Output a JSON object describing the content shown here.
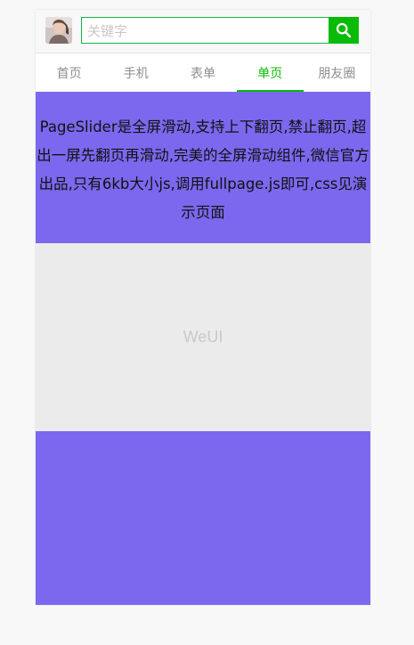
{
  "header": {
    "avatar_icon": "user-avatar-photo",
    "search": {
      "placeholder": "关键字",
      "value": "",
      "button_icon": "search-icon"
    }
  },
  "tabs": [
    {
      "label": "首页",
      "active": false
    },
    {
      "label": "手机",
      "active": false
    },
    {
      "label": "表单",
      "active": false
    },
    {
      "label": "单页",
      "active": true
    },
    {
      "label": "朋友圈",
      "active": false
    }
  ],
  "sections": {
    "intro_text": "PageSlider是全屏滑动,支持上下翻页,禁止翻页,超出一屏先翻页再滑动,完美的全屏滑动组件,微信官方出品,只有6kb大小js,调用fullpage.js即可,css见演示页面",
    "placeholder_label": "WeUI"
  },
  "colors": {
    "accent_green": "#09bb07",
    "search_border": "#16b14a",
    "section_purple": "#7b68ee",
    "section_gray": "#ebebeb"
  }
}
